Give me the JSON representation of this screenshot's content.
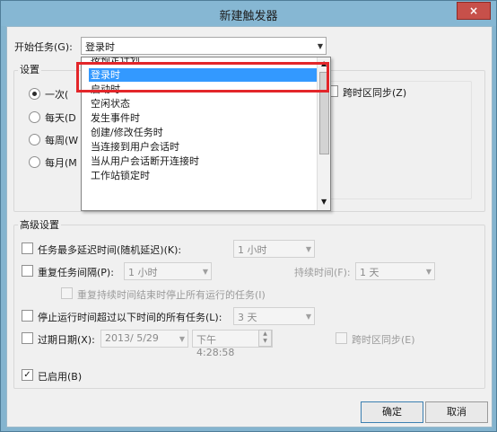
{
  "window": {
    "title": "新建触发器",
    "close_glyph": "×"
  },
  "start_task": {
    "label": "开始任务(G):",
    "value": "登录时"
  },
  "dropdown": {
    "items": [
      "按预定计划",
      "登录时",
      "启动时",
      "空闲状态",
      "发生事件时",
      "创建/修改任务时",
      "当连接到用户会话时",
      "当从用户会话断开连接时",
      "工作站锁定时"
    ],
    "selected_index": 1
  },
  "settings": {
    "group_label": "设置",
    "options": [
      "一次(",
      "每天(D",
      "每周(W",
      "每月(M"
    ],
    "selected_index": 0,
    "sync_timezone": "跨时区同步(Z)"
  },
  "advanced": {
    "group_label": "高级设置",
    "delay_label": "任务最多延迟时间(随机延迟)(K):",
    "delay_value": "1 小时",
    "repeat_label": "重复任务间隔(P):",
    "repeat_value": "1 小时",
    "duration_label": "持续时间(F):",
    "duration_value": "1 天",
    "stop_all_label": "重复持续时间结束时停止所有运行的任务(I)",
    "stop_over_label": "停止运行时间超过以下时间的所有任务(L):",
    "stop_over_value": "3 天",
    "expire_label": "过期日期(X):",
    "expire_date": "2013/  5/29",
    "expire_time": "下午   4:28:58",
    "expire_sync_label": "跨时区同步(E)",
    "enabled_label": "已启用(B)"
  },
  "buttons": {
    "ok": "确定",
    "cancel": "取消"
  },
  "colors": {
    "selection": "#3399ff",
    "highlight_box": "#e3262a",
    "title_bar": "#86b7d3"
  }
}
